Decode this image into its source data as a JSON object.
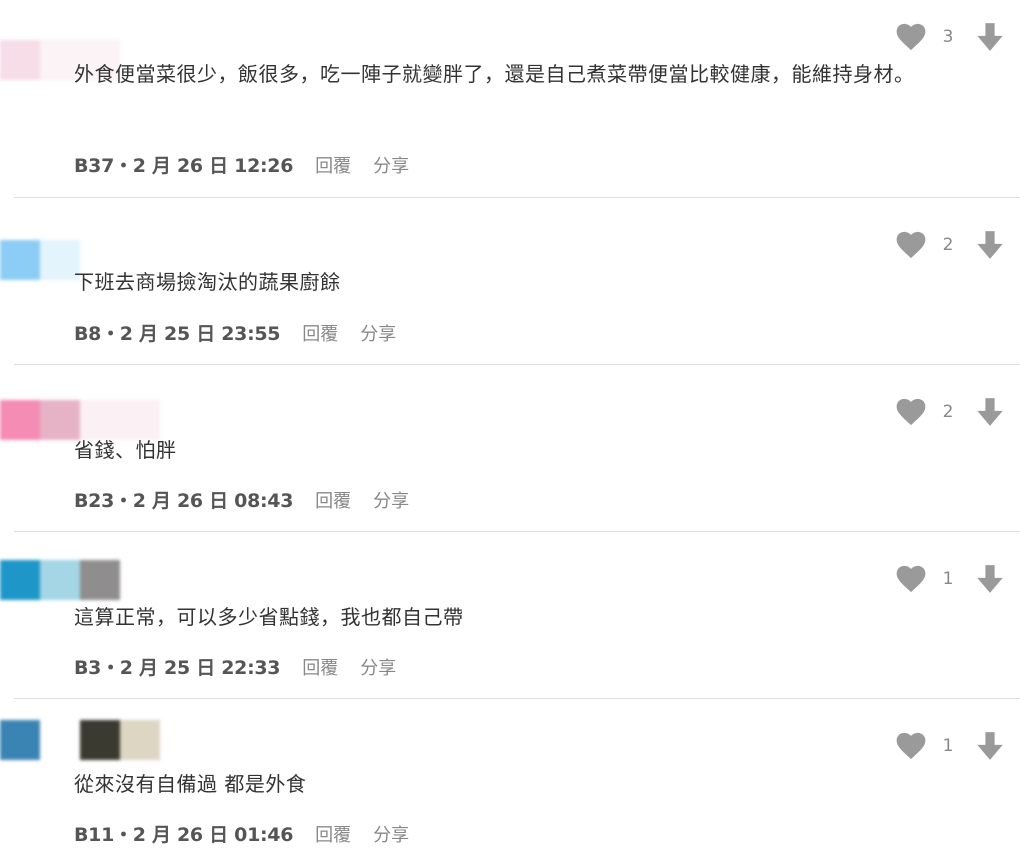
{
  "colors": {
    "icon_gray": "#9a9a9a",
    "text": "#333333",
    "meta": "#555555",
    "action": "#888888",
    "divider": "#dedede"
  },
  "icons": {
    "like": "heart-icon",
    "dislike": "down-arrow-icon"
  },
  "comments": [
    {
      "avatar_colors": [
        "#f6dde8",
        "#fbf3f6"
      ],
      "text": "外食便當菜很少，飯很多，吃一陣子就變胖了，還是自己煮菜帶便當比較健康，能維持身材。",
      "floor_time": "B37・2 月 26 日 12:26",
      "reply": "回覆",
      "share": "分享",
      "likes": "3"
    },
    {
      "avatar_colors": [
        "#8ccdf5",
        "#e3f4fc"
      ],
      "text": "下班去商場撿淘汰的蔬果廚餘",
      "floor_time": "B8・2 月 25 日 23:55",
      "reply": "回覆",
      "share": "分享",
      "likes": "2"
    },
    {
      "avatar_colors": [
        "#f48cb4",
        "#e6b3c6",
        "#fbf0f4"
      ],
      "text": "省錢、怕胖",
      "floor_time": "B23・2 月 26 日 08:43",
      "reply": "回覆",
      "share": "分享",
      "likes": "2"
    },
    {
      "avatar_colors": [
        "#1e97c8",
        "#a4d6e6",
        "#8f8d8d"
      ],
      "text": "這算正常，可以多少省點錢，我也都自己帶",
      "floor_time": "B3・2 月 25 日 22:33",
      "reply": "回覆",
      "share": "分享",
      "likes": "1"
    },
    {
      "avatar_colors": [
        "#3a84b4",
        "#ffffff",
        "#3a3a30",
        "#ddd6c3"
      ],
      "text": "從來沒有自備過 都是外食",
      "floor_time": "B11・2 月 26 日 01:46",
      "reply": "回覆",
      "share": "分享",
      "likes": "1"
    }
  ]
}
